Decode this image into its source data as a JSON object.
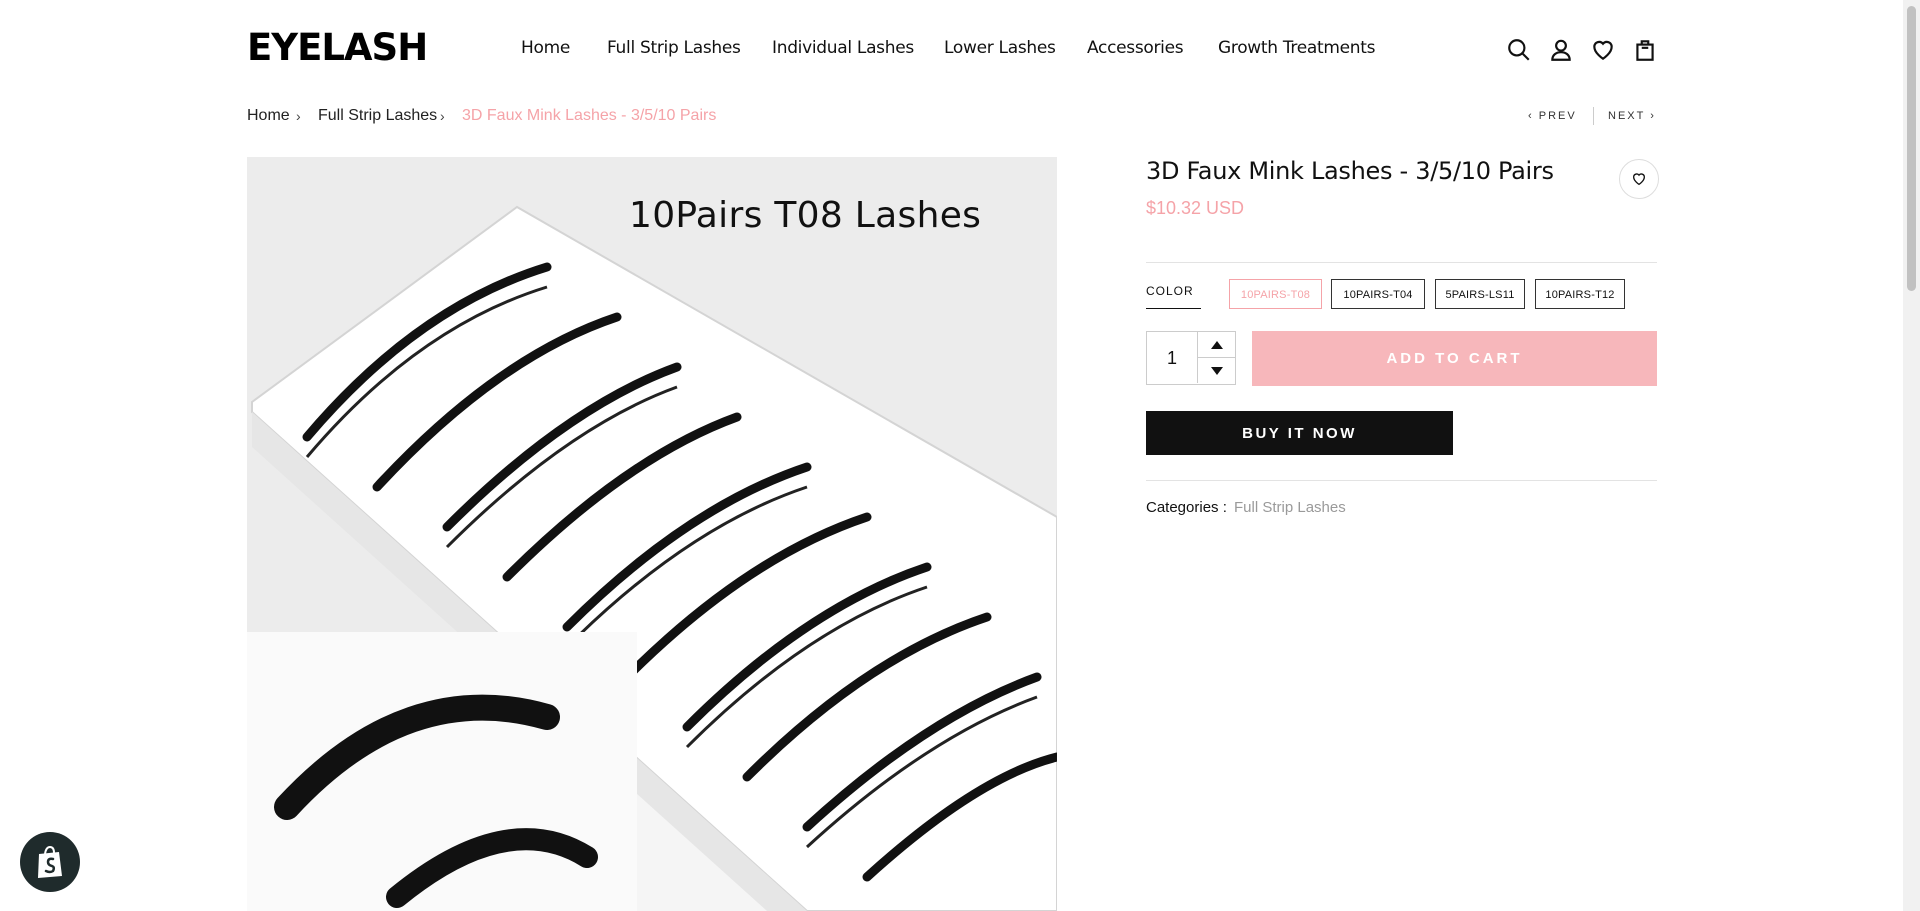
{
  "header": {
    "logo": "EYELASH",
    "nav": [
      {
        "label": "Home"
      },
      {
        "label": "Full Strip Lashes"
      },
      {
        "label": "Individual Lashes"
      },
      {
        "label": "Lower Lashes"
      },
      {
        "label": "Accessories"
      },
      {
        "label": "Growth Treatments"
      }
    ],
    "icons": [
      "search-icon",
      "account-icon",
      "wishlist-icon",
      "cart-icon"
    ]
  },
  "breadcrumb": {
    "items": [
      "Home",
      "Full Strip Lashes",
      "3D Faux Mink Lashes - 3/5/10 Pairs"
    ],
    "separator": "›",
    "prev": "PREV",
    "next": "NEXT"
  },
  "product": {
    "image_caption": "10Pairs T08 Lashes",
    "title": "3D Faux Mink Lashes - 3/5/10 Pairs",
    "price": "$10.32 USD",
    "color_label": "COLOR",
    "colors": [
      "10PAIRS-T08",
      "10PAIRS-T04",
      "5PAIRS-LS11",
      "10PAIRS-T12"
    ],
    "selected_color": "10PAIRS-T08",
    "quantity": "1",
    "add_to_cart": "ADD TO CART",
    "buy_now": "BUY IT NOW",
    "categories_label": "Categories :",
    "category": "Full Strip Lashes"
  },
  "colors": {
    "accent": "#f5a3a8",
    "add_to_cart_bg": "#f7b7bb",
    "buy_now_bg": "#111111",
    "shopify_badge": "#1f2b2c"
  }
}
